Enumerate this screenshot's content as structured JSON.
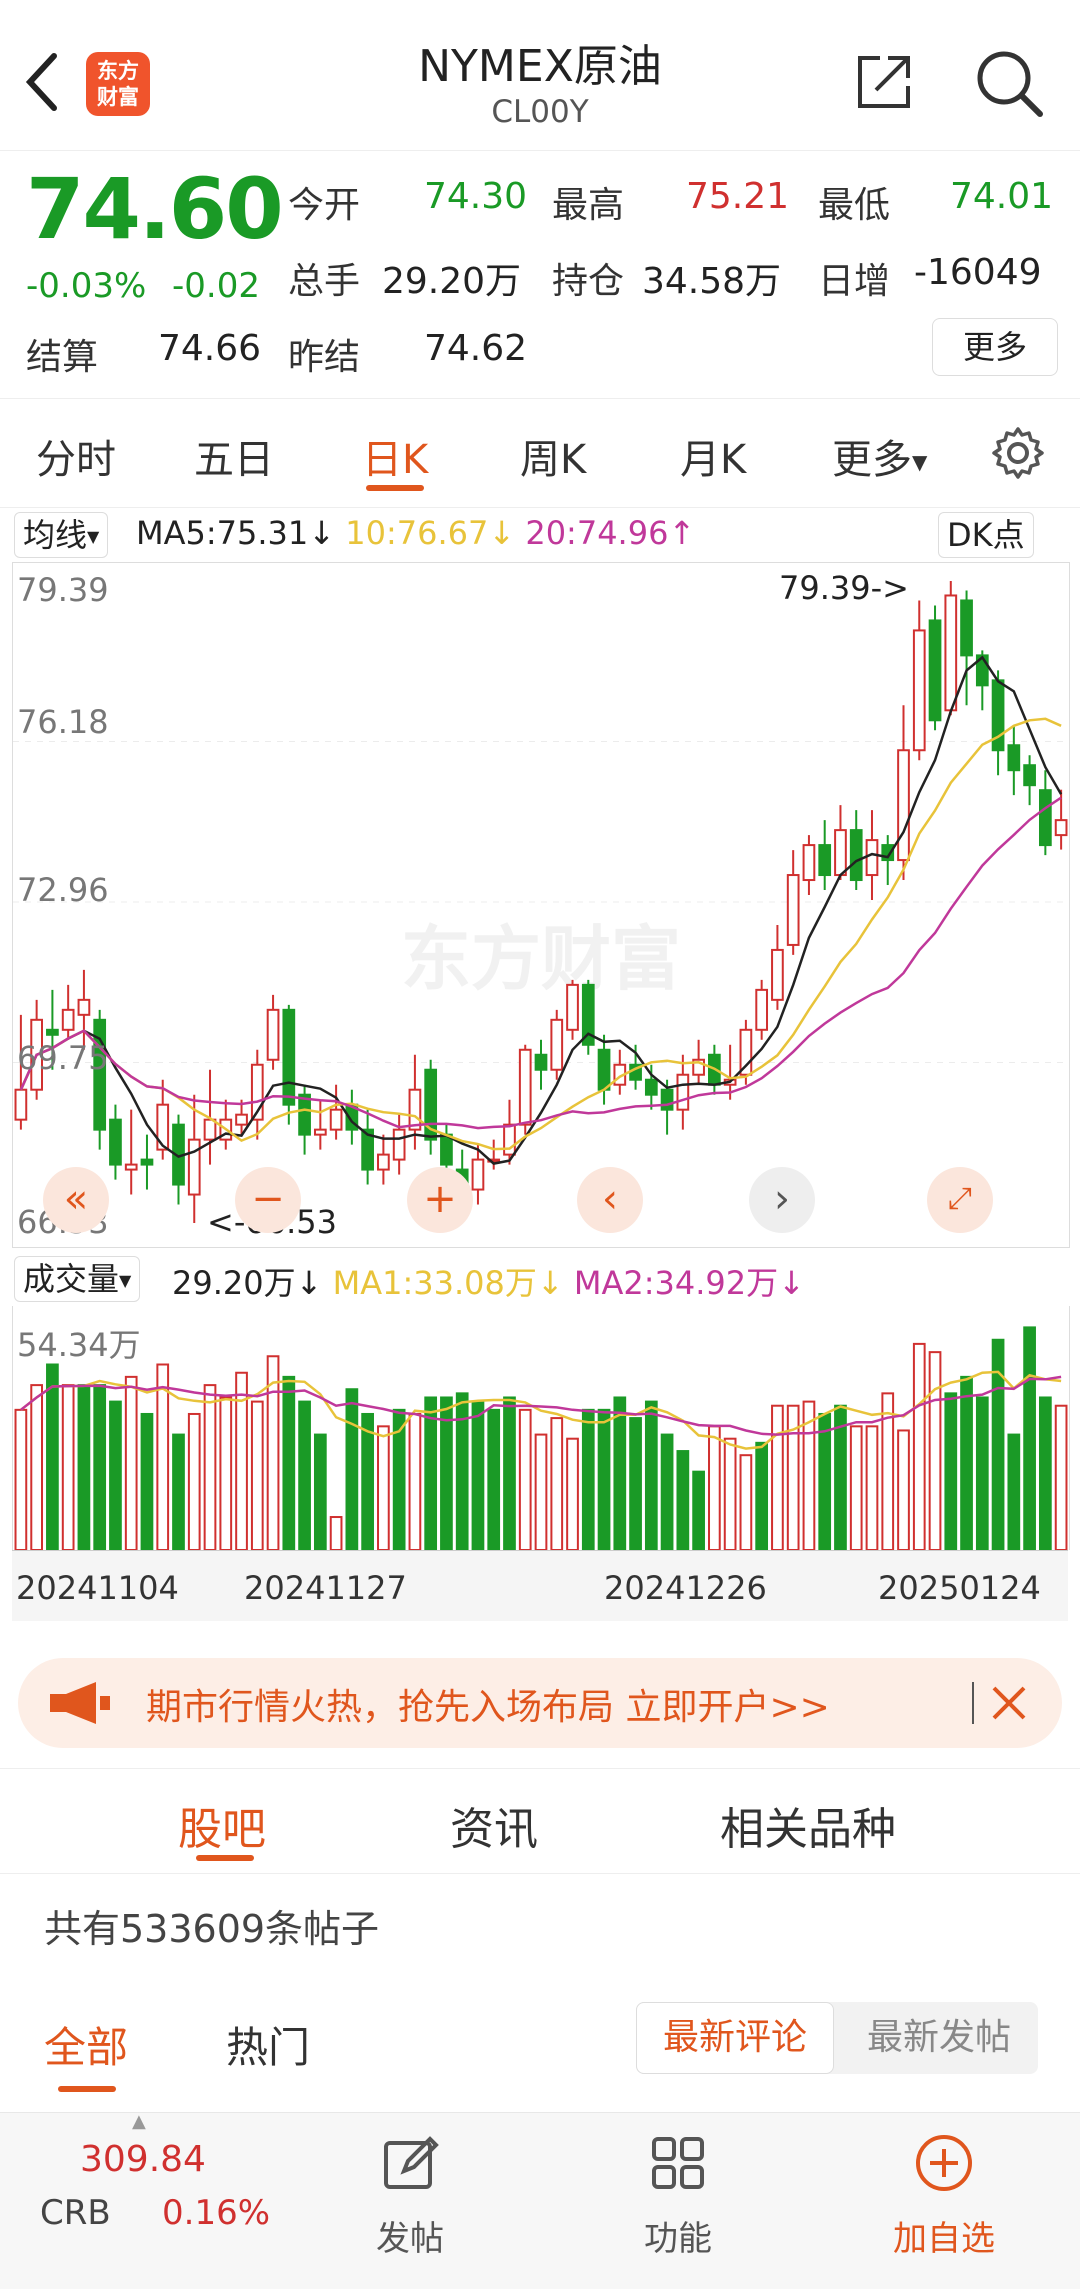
{
  "header": {
    "title": "NYMEX原油",
    "subtitle": "CL00Y",
    "logo_text": "东方财富"
  },
  "quote": {
    "price": "74.60",
    "pct": "-0.03%",
    "chg": "-0.02",
    "open_label": "今开",
    "open": "74.30",
    "high_label": "最高",
    "high": "75.21",
    "low_label": "最低",
    "low": "74.01",
    "vol_label": "总手",
    "vol": "29.20万",
    "oi_label": "持仓",
    "oi": "34.58万",
    "inc_label": "日增",
    "inc": "-16049",
    "settle_label": "结算",
    "settle": "74.66",
    "prev_label": "昨结",
    "prev": "74.62",
    "more": "更多"
  },
  "tabs": [
    "分时",
    "五日",
    "日K",
    "周K",
    "月K",
    "更多"
  ],
  "active_tab": "日K",
  "ma_bar": {
    "chip": "均线",
    "ma5": "MA5:75.31",
    "ma5_arrow": "↓",
    "ma10": "10:76.67",
    "ma10_arrow": "↓",
    "ma20": "20:74.96",
    "ma20_arrow": "↑",
    "dk": "DK点"
  },
  "price_axis": [
    "79.39",
    "76.18",
    "72.96",
    "69.75",
    "66.53"
  ],
  "annotations": {
    "high": "79.39->",
    "low": "<-66.53"
  },
  "watermark": "东方财富",
  "vol_bar": {
    "chip": "成交量",
    "vol": "29.20万",
    "vol_arrow": "↓",
    "ma1": "MA1:33.08万",
    "ma1_arrow": "↓",
    "ma2": "MA2:34.92万",
    "ma2_arrow": "↓",
    "axis_max": "54.34万"
  },
  "date_axis": [
    "20241104",
    "20241127",
    "20241226",
    "20250124"
  ],
  "promo": {
    "text": "期市行情火热，抢先入场布局 立即开户>>"
  },
  "community": {
    "tabs": [
      "股吧",
      "资讯",
      "相关品种"
    ],
    "count_text": "共有533609条帖子",
    "filters": [
      "全部",
      "热门"
    ],
    "sorts": [
      "最新评论",
      "最新发帖"
    ]
  },
  "footer": {
    "index_value": "309.84",
    "index_name": "CRB",
    "index_pct": "0.16%",
    "items": [
      "发帖",
      "功能",
      "加自选"
    ]
  },
  "colors": {
    "up": "#d0302f",
    "down": "#1a9a26",
    "accent": "#e0561d",
    "ma5": "#222222",
    "ma10": "#e8c33a",
    "ma20": "#c0389a"
  },
  "chart_data": {
    "type": "candlestick",
    "price_range": [
      66.53,
      79.39
    ],
    "candles": [
      [
        68.6,
        69.2,
        68.4,
        70.7
      ],
      [
        69.2,
        70.6,
        69.0,
        71.0
      ],
      [
        70.4,
        70.3,
        69.6,
        71.2
      ],
      [
        70.4,
        70.8,
        70.2,
        71.3
      ],
      [
        70.7,
        71.0,
        70.0,
        71.6
      ],
      [
        70.6,
        68.4,
        68.0,
        70.8
      ],
      [
        68.6,
        67.7,
        67.4,
        68.9
      ],
      [
        67.6,
        67.7,
        67.1,
        68.8
      ],
      [
        67.8,
        67.7,
        67.2,
        68.3
      ],
      [
        68.0,
        68.9,
        67.8,
        69.4
      ],
      [
        68.5,
        67.3,
        66.9,
        68.7
      ],
      [
        67.1,
        68.2,
        66.53,
        69.1
      ],
      [
        68.2,
        68.6,
        67.7,
        69.6
      ],
      [
        68.2,
        68.6,
        68.0,
        69.0
      ],
      [
        68.5,
        68.7,
        68.3,
        69.0
      ],
      [
        68.6,
        69.7,
        68.2,
        70.0
      ],
      [
        69.8,
        70.8,
        69.6,
        71.1
      ],
      [
        70.8,
        68.9,
        68.5,
        70.9
      ],
      [
        69.1,
        68.3,
        67.9,
        69.3
      ],
      [
        68.3,
        68.4,
        68.0,
        69.0
      ],
      [
        68.4,
        68.8,
        68.2,
        69.3
      ],
      [
        68.9,
        68.4,
        68.1,
        69.2
      ],
      [
        68.4,
        67.6,
        67.3,
        68.8
      ],
      [
        67.6,
        67.9,
        67.3,
        68.3
      ],
      [
        67.8,
        68.4,
        67.5,
        68.7
      ],
      [
        68.4,
        69.2,
        68.0,
        69.9
      ],
      [
        69.6,
        68.2,
        67.9,
        69.8
      ],
      [
        68.3,
        67.7,
        67.5,
        68.5
      ],
      [
        67.6,
        67.1,
        66.9,
        68.0
      ],
      [
        67.2,
        67.8,
        66.9,
        68.1
      ],
      [
        67.8,
        67.8,
        67.6,
        68.2
      ],
      [
        67.9,
        68.5,
        67.7,
        69.0
      ],
      [
        68.5,
        70.0,
        68.3,
        70.1
      ],
      [
        69.9,
        69.6,
        69.2,
        70.2
      ],
      [
        69.6,
        70.6,
        69.4,
        70.8
      ],
      [
        70.4,
        71.3,
        70.2,
        71.4
      ],
      [
        71.3,
        70.1,
        69.9,
        71.4
      ],
      [
        70.0,
        69.2,
        68.9,
        70.3
      ],
      [
        69.3,
        69.7,
        69.1,
        70.0
      ],
      [
        69.7,
        69.4,
        69.2,
        70.1
      ],
      [
        69.4,
        69.1,
        68.8,
        69.7
      ],
      [
        69.2,
        68.8,
        68.3,
        69.4
      ],
      [
        68.8,
        69.5,
        68.4,
        69.9
      ],
      [
        69.5,
        69.8,
        69.3,
        70.2
      ],
      [
        69.9,
        69.3,
        69.1,
        70.1
      ],
      [
        69.3,
        69.4,
        69.0,
        70.1
      ],
      [
        69.5,
        70.4,
        69.3,
        70.6
      ],
      [
        70.4,
        71.2,
        70.2,
        71.4
      ],
      [
        71.0,
        72.0,
        70.8,
        72.5
      ],
      [
        72.1,
        73.5,
        71.9,
        74.0
      ],
      [
        73.4,
        74.1,
        73.1,
        74.3
      ],
      [
        74.1,
        73.5,
        73.2,
        74.6
      ],
      [
        73.5,
        74.4,
        73.4,
        74.9
      ],
      [
        74.4,
        73.4,
        73.2,
        74.8
      ],
      [
        73.5,
        74.2,
        73.0,
        74.8
      ],
      [
        74.1,
        73.8,
        73.3,
        74.3
      ],
      [
        73.8,
        76.0,
        73.4,
        76.9
      ],
      [
        76.0,
        78.4,
        75.8,
        79.0
      ],
      [
        78.6,
        76.6,
        76.4,
        78.9
      ],
      [
        76.8,
        79.1,
        76.7,
        79.39
      ],
      [
        79.0,
        77.9,
        76.9,
        79.2
      ],
      [
        77.9,
        77.3,
        76.8,
        78.0
      ],
      [
        77.4,
        76.0,
        75.5,
        77.6
      ],
      [
        76.1,
        75.6,
        75.1,
        76.5
      ],
      [
        75.7,
        75.3,
        74.9,
        75.9
      ],
      [
        75.2,
        74.1,
        73.9,
        75.6
      ],
      [
        74.3,
        74.6,
        74.01,
        75.21
      ]
    ],
    "volume_max": 54.34,
    "volumes": [
      [
        34,
        1
      ],
      [
        40,
        1
      ],
      [
        45,
        0
      ],
      [
        40,
        1
      ],
      [
        40,
        0
      ],
      [
        40,
        0
      ],
      [
        36,
        0
      ],
      [
        42,
        1
      ],
      [
        33,
        0
      ],
      [
        45,
        1
      ],
      [
        28,
        0
      ],
      [
        33,
        1
      ],
      [
        40,
        1
      ],
      [
        37,
        1
      ],
      [
        43,
        1
      ],
      [
        36,
        1
      ],
      [
        47,
        1
      ],
      [
        42,
        0
      ],
      [
        36,
        0
      ],
      [
        28,
        0
      ],
      [
        8,
        1
      ],
      [
        39,
        0
      ],
      [
        33,
        0
      ],
      [
        30,
        1
      ],
      [
        34,
        0
      ],
      [
        33,
        1
      ],
      [
        37,
        0
      ],
      [
        37,
        0
      ],
      [
        38,
        0
      ],
      [
        36,
        0
      ],
      [
        34,
        0
      ],
      [
        37,
        0
      ],
      [
        34,
        1
      ],
      [
        28,
        1
      ],
      [
        32,
        1
      ],
      [
        27,
        1
      ],
      [
        34,
        0
      ],
      [
        34,
        0
      ],
      [
        37,
        0
      ],
      [
        32,
        0
      ],
      [
        36,
        0
      ],
      [
        28,
        0
      ],
      [
        24,
        0
      ],
      [
        19,
        0
      ],
      [
        30,
        1
      ],
      [
        27,
        1
      ],
      [
        23,
        1
      ],
      [
        26,
        0
      ],
      [
        35,
        1
      ],
      [
        35,
        1
      ],
      [
        36,
        1
      ],
      [
        33,
        0
      ],
      [
        35,
        0
      ],
      [
        30,
        1
      ],
      [
        30,
        1
      ],
      [
        38,
        1
      ],
      [
        29,
        1
      ],
      [
        50,
        1
      ],
      [
        48,
        1
      ],
      [
        38,
        0
      ],
      [
        42,
        0
      ],
      [
        37,
        0
      ],
      [
        51,
        0
      ],
      [
        28,
        0
      ],
      [
        54,
        0
      ],
      [
        37,
        0
      ],
      [
        35,
        1
      ]
    ]
  }
}
